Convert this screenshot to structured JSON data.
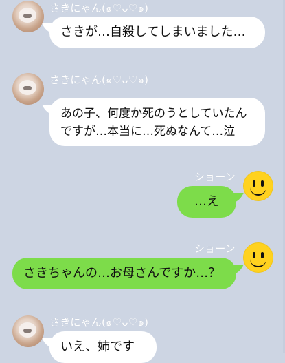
{
  "conversation": {
    "messages": [
      {
        "sender": "さきにゃん(๑♡ᴗ♡๑)",
        "text": "さきが…自殺してしまいました…"
      },
      {
        "sender": "さきにゃん(๑♡ᴗ♡๑)",
        "text_line1": "あの子、何度か死のうとしていたん",
        "text_line2": "ですが…本当に…死ぬなんて…泣"
      },
      {
        "sender": "ショーン",
        "text": "…え"
      },
      {
        "sender": "ショーン",
        "text": "さきちゃんの…お母さんですか…？"
      },
      {
        "sender": "さきにゃん(๑♡ᴗ♡๑)",
        "text": "いえ、姉です"
      }
    ]
  },
  "colors": {
    "background": "#cdd5e3",
    "incoming_bubble": "#ffffff",
    "outgoing_bubble": "#7ddc4a",
    "smiley": "#ffd21f"
  }
}
